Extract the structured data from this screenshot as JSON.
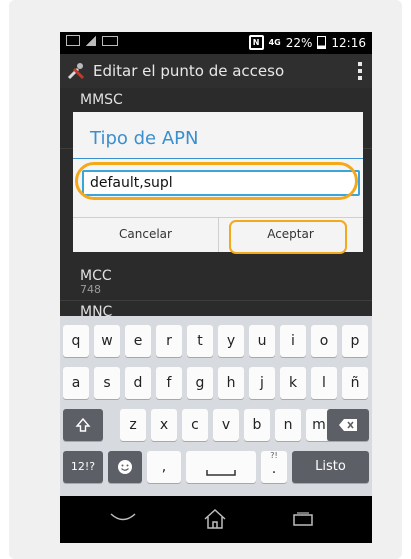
{
  "status_bar": {
    "signal_label": "?.il",
    "network_label": "4G",
    "battery": "22%",
    "time": "12:16",
    "nfc_label": "N"
  },
  "action_bar": {
    "title": "Editar el punto de acceso"
  },
  "settings": [
    {
      "title": "MMSC",
      "value": ""
    },
    {
      "title": "MCC",
      "value": "748"
    },
    {
      "title": "MNC",
      "value": ""
    }
  ],
  "dialog": {
    "title": "Tipo de APN",
    "input_value": "default,supl",
    "cancel_label": "Cancelar",
    "accept_label": "Aceptar"
  },
  "keyboard": {
    "row1": [
      "q",
      "w",
      "e",
      "r",
      "t",
      "y",
      "u",
      "i",
      "o",
      "p"
    ],
    "row2": [
      "a",
      "s",
      "d",
      "f",
      "g",
      "h",
      "j",
      "k",
      "l",
      "ñ"
    ],
    "row3": [
      "z",
      "x",
      "c",
      "v",
      "b",
      "n",
      "m"
    ],
    "shift_icon": "shift-icon",
    "backspace_icon": "backspace-icon",
    "symbols_label": "12!?",
    "emoji_icon": "emoji-icon",
    "comma_label": ",",
    "space_icon": "space-icon",
    "period_label": ".",
    "period_hint": "?!",
    "done_label": "Listo"
  },
  "nav_bar": {
    "back_icon": "back-icon",
    "home_icon": "home-icon",
    "recents_icon": "recents-icon"
  },
  "colors": {
    "accent_blue": "#3a8fcf",
    "highlight_orange": "#f4a81b"
  }
}
